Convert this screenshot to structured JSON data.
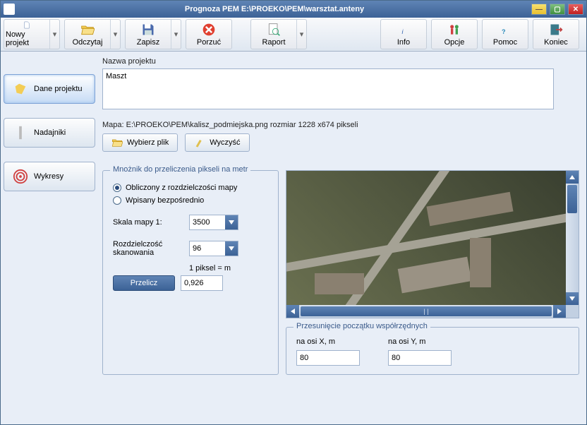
{
  "title": "Prognoza PEM    E:\\PROEKO\\PEM\\warsztat.anteny",
  "toolbar": {
    "new_project": "Nowy projekt",
    "read": "Odczytaj",
    "save": "Zapisz",
    "discard": "Porzuć",
    "report": "Raport",
    "info": "Info",
    "options": "Opcje",
    "help": "Pomoc",
    "end": "Koniec"
  },
  "sidebar": {
    "project_data": "Dane projektu",
    "transmitters": "Nadajniki",
    "charts": "Wykresy"
  },
  "project": {
    "name_label": "Nazwa projektu",
    "name_value": "Maszt"
  },
  "map": {
    "label": "Mapa: E:\\PROEKO\\PEM\\kalisz_podmiejska.png rozmiar 1228 x674 pikseli",
    "choose_file": "Wybierz plik",
    "clear": "Wyczyść"
  },
  "multiplier": {
    "legend": "Mnożnik do przeliczenia pikseli na metr",
    "radio_calculated": "Obliczony z rozdzielczości mapy",
    "radio_direct": "Wpisany bezpośrednio",
    "scale_label": "Skala mapy    1:",
    "scale_value": "3500",
    "scan_res_label": "Rozdzielczość skanowania",
    "scan_res_value": "96",
    "pixel_label": "1 piksel =    m",
    "pixel_value": "0,926",
    "calc_btn": "Przelicz"
  },
  "offset": {
    "legend": "Przesunięcie początku współrzędnych",
    "x_label": "na osi X, m",
    "y_label": "na osi Y, m",
    "x_value": "80",
    "y_value": "80"
  }
}
